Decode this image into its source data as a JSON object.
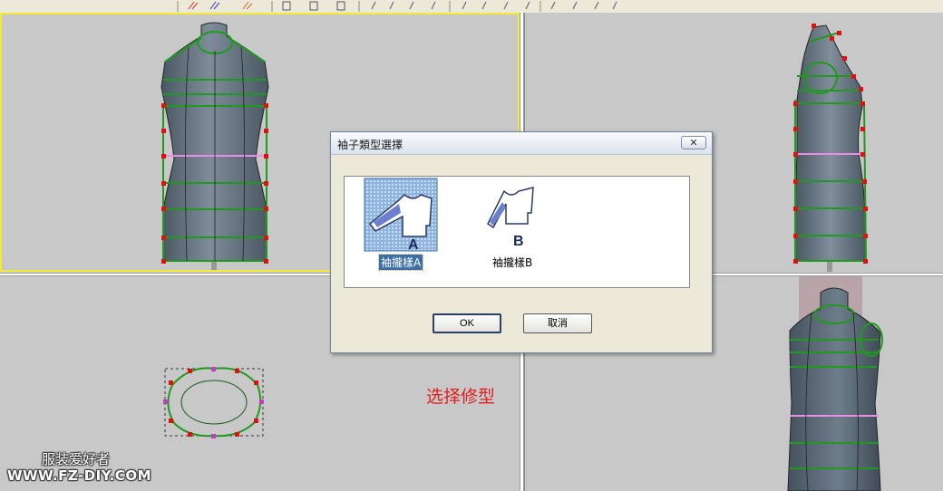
{
  "dialog": {
    "title": "袖子類型選擇",
    "close_glyph": "✕",
    "options": [
      {
        "label": "袖攏樣A",
        "icon": "sleeve-type-a-icon",
        "icon_letter": "A",
        "selected": true
      },
      {
        "label": "袖攏樣B",
        "icon": "sleeve-type-b-icon",
        "icon_letter": "B",
        "selected": false
      }
    ],
    "ok_label": "OK",
    "cancel_label": "取消"
  },
  "annotation": "选择修型",
  "watermark": {
    "line1": "服装爱好者",
    "line2": "WWW.FZ-DIY.COM"
  },
  "colors": {
    "viewport_bg": "#c8c8c8",
    "mannequin": "#6c7b88",
    "guide_line": "#1f9a1f",
    "waist_line": "#e88ee8",
    "control_point": "#e01010",
    "active_viewport_border": "#f2ea38",
    "selection": "#3a6ea5",
    "annotation": "#e02020"
  }
}
